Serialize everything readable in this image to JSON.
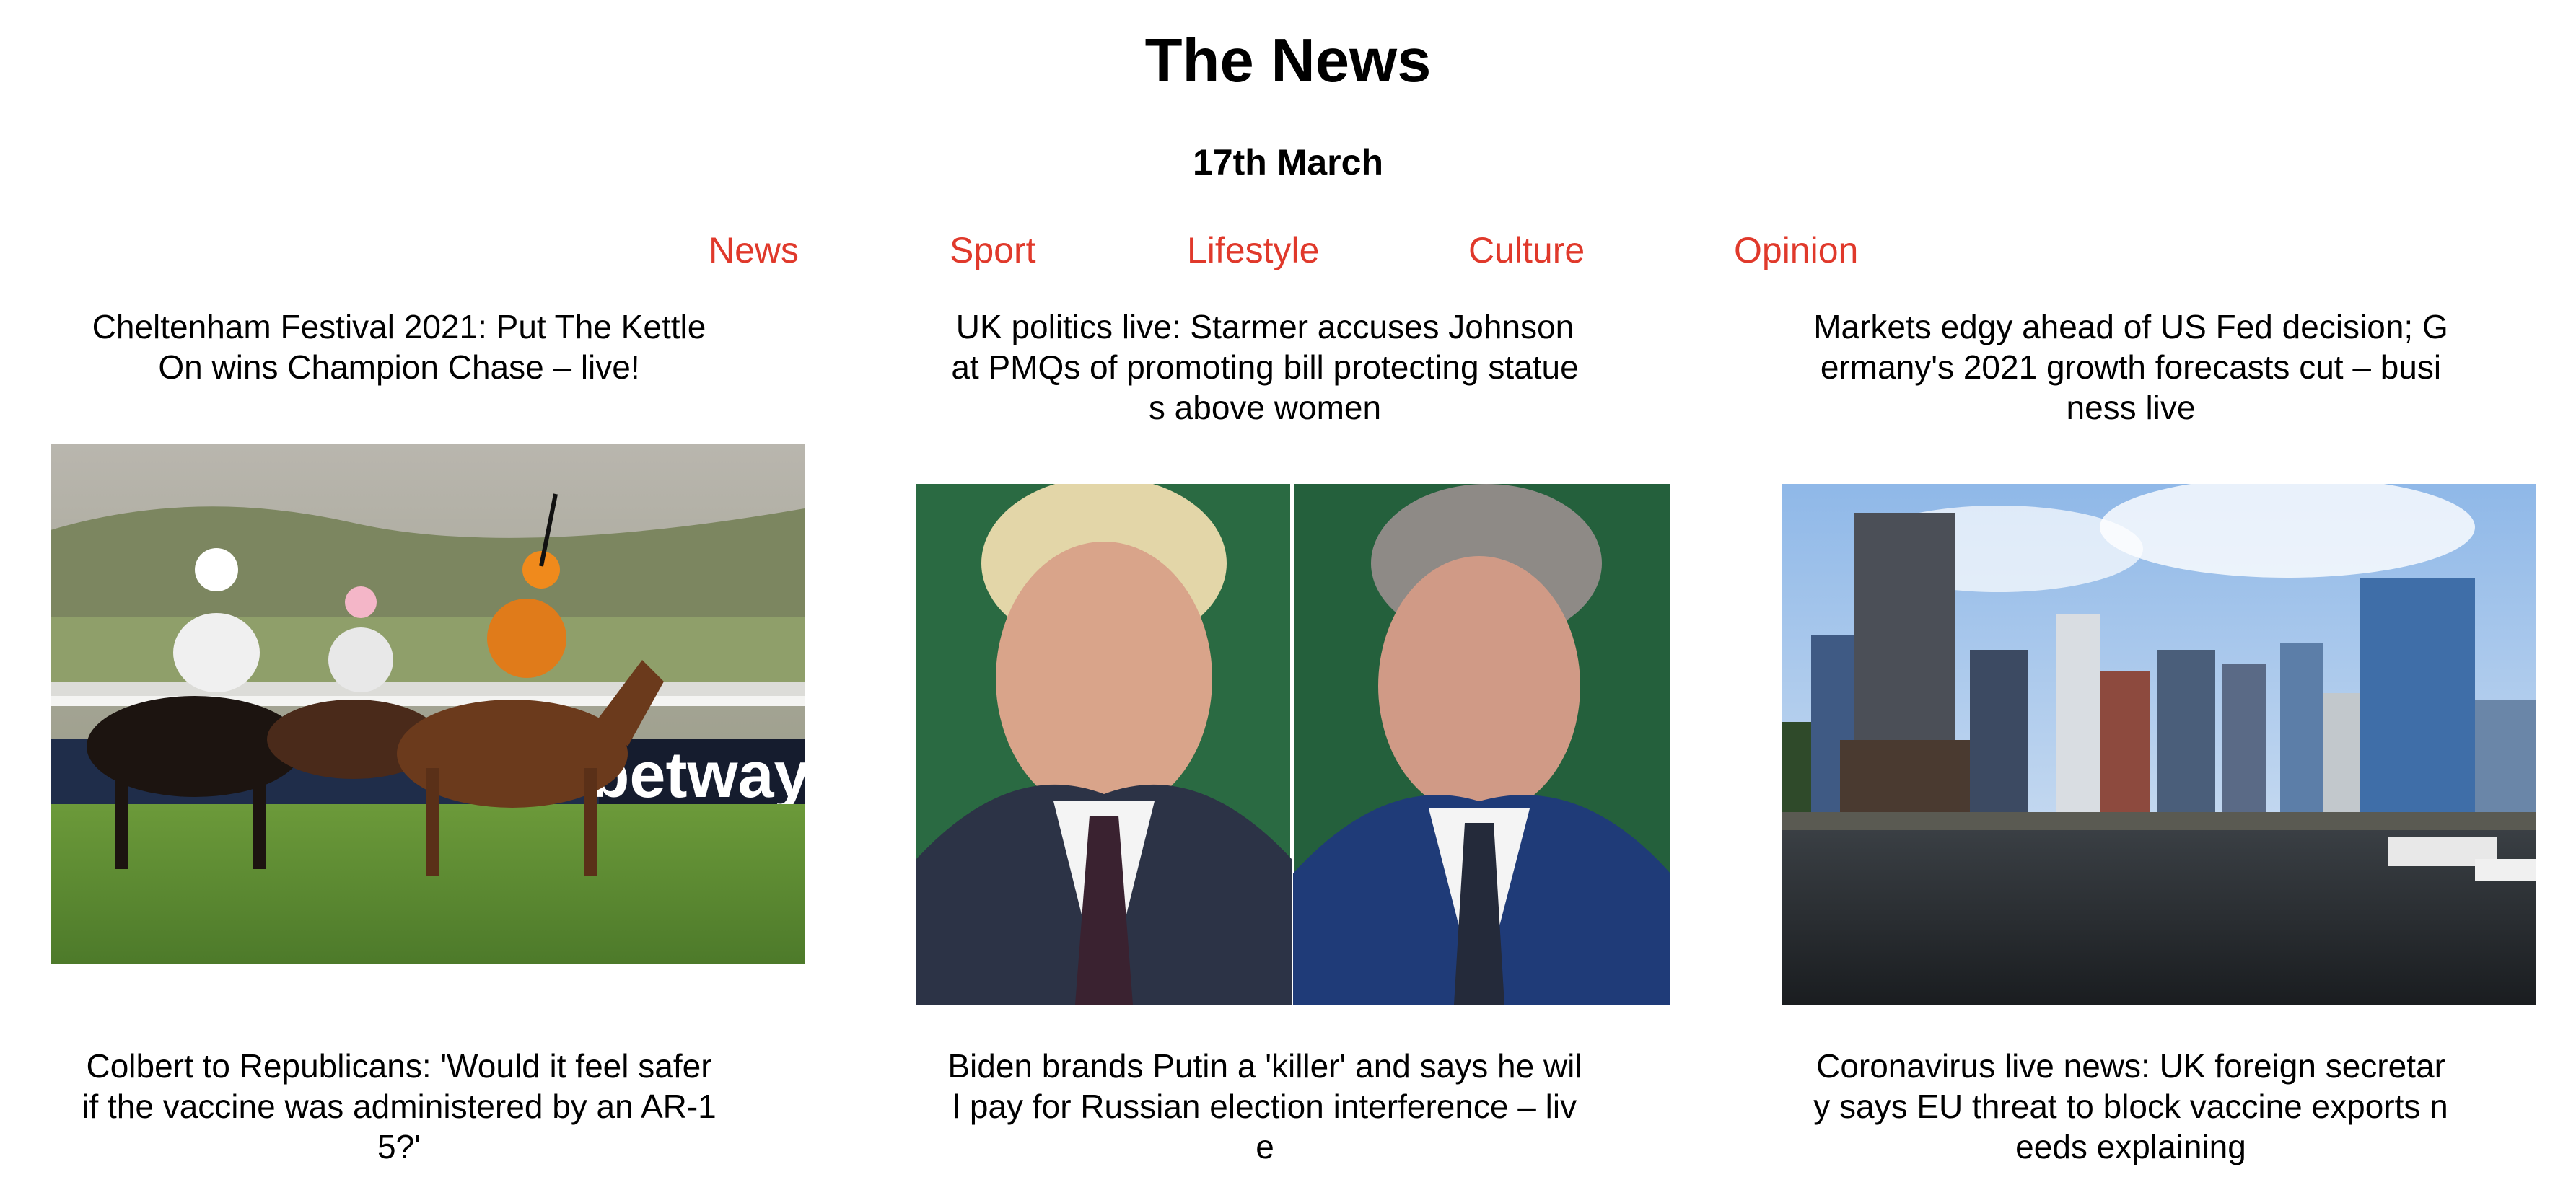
{
  "header": {
    "title": "The News",
    "date": "17th March"
  },
  "nav": {
    "items": [
      {
        "label": "News"
      },
      {
        "label": "Sport"
      },
      {
        "label": "Lifestyle"
      },
      {
        "label": "Culture"
      },
      {
        "label": "Opinion"
      }
    ]
  },
  "articles": [
    {
      "headline": "Cheltenham Festival 2021: Put The Kettle On wins Champion Chase – live!",
      "image": "horse-racing-photo",
      "image_text": [
        "betway"
      ]
    },
    {
      "headline": "UK politics live: Starmer accuses Johnson at PMQs of promoting bill protecting statues above women",
      "image": "politicians-photo"
    },
    {
      "headline": "Markets edgy ahead of US Fed decision; Germany's 2021 growth forecasts cut – business live",
      "image": "city-skyline-photo"
    },
    {
      "headline": "Colbert to Republicans: 'Would it feel safer if the vaccine was administered by an AR-15?'"
    },
    {
      "headline": "Biden brands Putin a 'killer' and says he will pay for Russian election interference – live"
    },
    {
      "headline": "Coronavirus live news: UK foreign secretary says EU threat to block vaccine exports needs explaining"
    }
  ],
  "colors": {
    "link": "#e0392b",
    "text": "#000000",
    "background": "#ffffff"
  }
}
